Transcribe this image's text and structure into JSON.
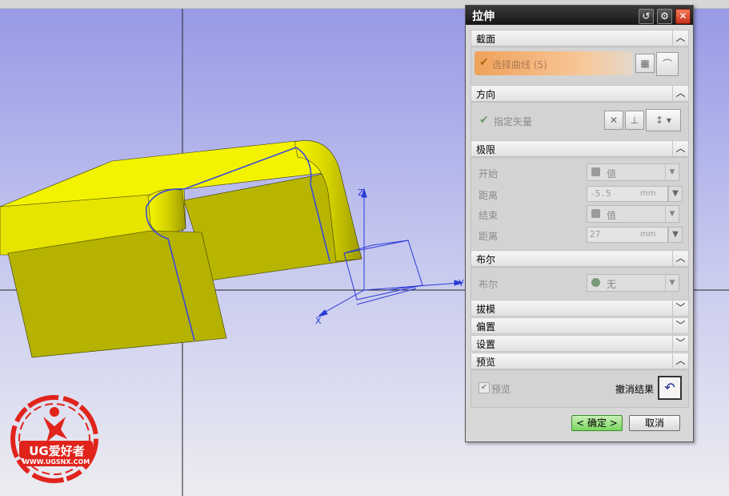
{
  "dialog": {
    "title": "拉伸",
    "title_buttons": [
      "reset-icon",
      "settings-icon",
      "close-icon"
    ],
    "sections": {
      "section": {
        "header": "截面",
        "chevron": "^",
        "select_curve_label": "选择曲线 (5)"
      },
      "direction": {
        "header": "方向",
        "chevron": "^",
        "vector_label": "指定矢量"
      },
      "limits": {
        "header": "极限",
        "chevron": "^",
        "start_label": "开始",
        "start_type": "值",
        "start_distance_label": "距离",
        "start_distance_value": "-5.5",
        "start_unit": "mm",
        "end_label": "结束",
        "end_type": "值",
        "end_distance_label": "距离",
        "end_distance_value": "27",
        "end_unit": "mm"
      },
      "boolean": {
        "header": "布尔",
        "chevron": "^",
        "label": "布尔",
        "value": "无"
      },
      "draft": {
        "header": "拔模",
        "chevron": "v"
      },
      "offset": {
        "header": "偏置",
        "chevron": "v"
      },
      "settings": {
        "header": "设置",
        "chevron": "v"
      },
      "preview": {
        "header": "预览",
        "chevron": "^",
        "preview_checkbox_label": "预览",
        "preview_checked": true,
        "undo_result_label": "撤消结果"
      }
    },
    "buttons": {
      "ok": "< 确定 >",
      "cancel": "取消"
    }
  },
  "viewport": {
    "background_top": "#9c9fe6",
    "background_bottom": "#e8e8ee",
    "model_color": "#f2f200",
    "model_shadow_color": "#b5b200",
    "curve_color": "#3b4bd6",
    "triad_axes": [
      "Z",
      "Y",
      "X"
    ]
  },
  "logo": {
    "brand": "UG爱好者",
    "url": "WWW.UGSNX.COM"
  }
}
